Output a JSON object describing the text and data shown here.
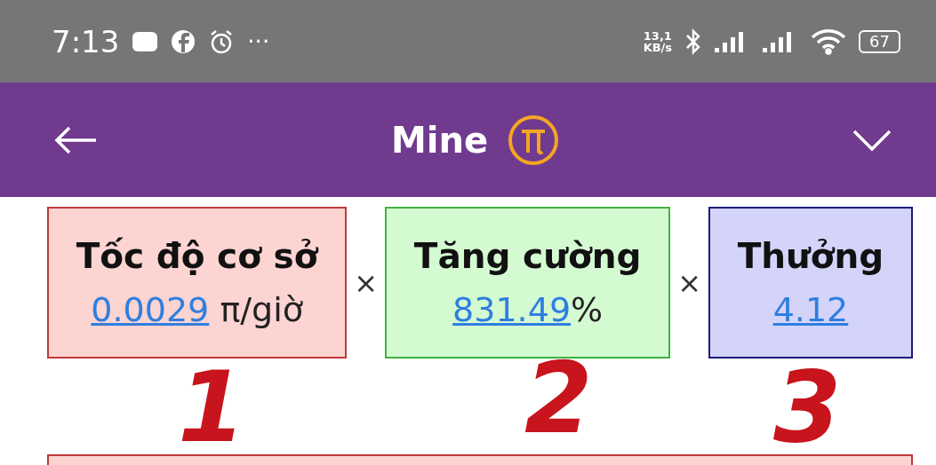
{
  "status_bar": {
    "time": "7:13",
    "more": "···",
    "speed": [
      "13,1",
      "KB/s"
    ],
    "battery": "67"
  },
  "header": {
    "title": "Mine"
  },
  "cards": [
    {
      "title": "Tốc độ cơ sở",
      "value": "0.0029",
      "unit": " π/giờ",
      "color": "#fcd4d2"
    },
    {
      "title": "Tăng cường",
      "value": "831.49",
      "unit": "%",
      "color": "#d4fad2"
    },
    {
      "title": "Thưởng",
      "value": "4.12",
      "color": "#d4d4fb"
    }
  ],
  "operator": "×",
  "annotations": [
    "1",
    "2",
    "3"
  ]
}
